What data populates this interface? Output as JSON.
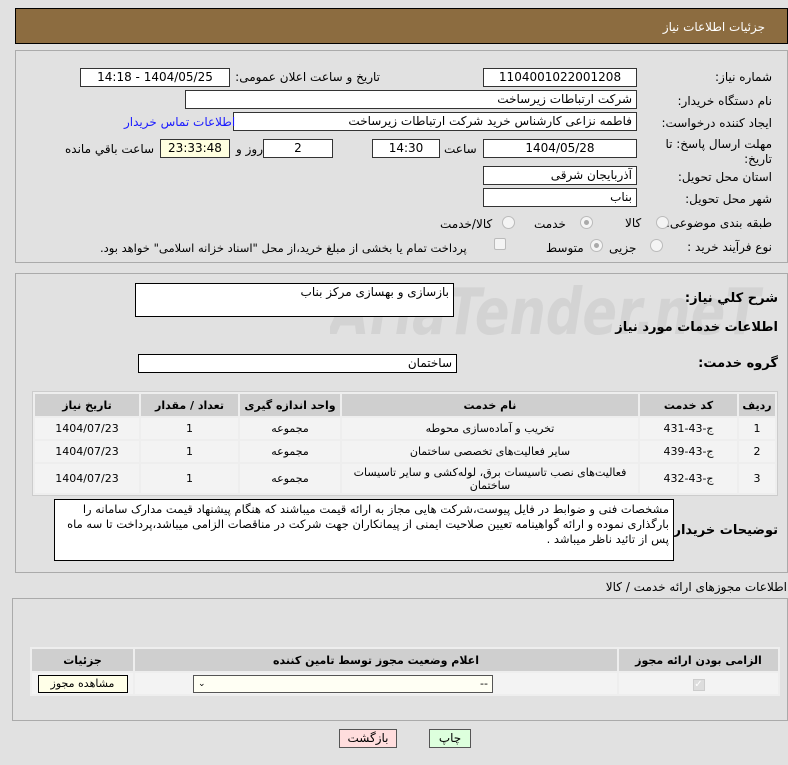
{
  "header": {
    "title": "جزئیات اطلاعات نیاز"
  },
  "form": {
    "need_number_label": "شماره نیاز:",
    "need_number": "1104001022001208",
    "announce_label": "تاریخ و ساعت اعلان عمومی:",
    "announce_value": "1404/05/25 - 14:18",
    "buyer_label": "نام دستگاه خریدار:",
    "buyer": "شرکت ارتباطات زیرساخت",
    "creator_label": "ایجاد کننده درخواست:",
    "creator": "فاطمه نزاعی کارشناس خرید شرکت ارتباطات زیرساخت",
    "contact_link": "اطلاعات تماس خریدار",
    "deadline_label": "مهلت ارسال پاسخ: تا تاریخ:",
    "deadline_date": "1404/05/28",
    "time_label": "ساعت",
    "deadline_time": "14:30",
    "days": "2",
    "days_label": "روز و",
    "remaining": "23:33:48",
    "remaining_label": "ساعت باقي مانده",
    "province_label": "استان محل تحویل:",
    "province": "آذربایجان شرقی",
    "city_label": "شهر محل تحویل:",
    "city": "بناب",
    "category_label": "طبقه بندی موضوعی:",
    "category_options": [
      "کالا",
      "خدمت",
      "کالا/خدمت"
    ],
    "process_label": "نوع فرآیند خرید :",
    "process_options": [
      "جزیی",
      "متوسط"
    ],
    "payment_note": "پرداخت تمام یا بخشی از مبلغ خرید،از محل \"اسناد خزانه اسلامی\" خواهد بود."
  },
  "details": {
    "desc_label": "شرح کلي نياز:",
    "desc": "بازسازی و بهسازی مرکز بناب",
    "services_title": "اطلاعات خدمات مورد نياز",
    "group_label": "گروه خدمت:",
    "group": "ساختمان",
    "columns": [
      "ردیف",
      "کد خدمت",
      "نام خدمت",
      "واحد اندازه گیری",
      "تعداد / مقدار",
      "تاریخ نیاز"
    ],
    "rows": [
      [
        "1",
        "ج-43-431",
        "تخریب و آماده‌سازی محوطه",
        "مجموعه",
        "1",
        "1404/07/23"
      ],
      [
        "2",
        "ج-43-439",
        "سایر فعالیت‌های تخصصی ساختمان",
        "مجموعه",
        "1",
        "1404/07/23"
      ],
      [
        "3",
        "ج-43-432",
        "فعالیت‌های نصب تاسیسات برق، لوله‌کشی و سایر تاسیسات ساختمان",
        "مجموعه",
        "1",
        "1404/07/23"
      ]
    ],
    "notes_label": "توضیحات خریدار:",
    "notes": "مشخصات فنی و ضوابط در فایل پیوست،شرکت هایی مجاز به ارائه قیمت میباشند که هنگام پیشنهاد قیمت مدارک سامانه را بارگذاری نموده و ارائه گواهینامه تعیین صلاحیت ایمنی از پیمانکاران جهت شرکت در مناقصات الزامی میباشد،پرداخت تا سه ماه پس از تائید ناظر میباشد ."
  },
  "permits": {
    "title": "اطلاعات مجوزهای ارائه خدمت / کالا",
    "columns": [
      "الزامی بودن ارائه مجوز",
      "اعلام وضعیت مجوز توسط تامین کننده",
      "جزئیات"
    ],
    "select_value": "--",
    "view_button": "مشاهده مجوز"
  },
  "buttons": {
    "back": "بازگشت",
    "print": "چاپ"
  },
  "watermark": "AriaTender.neT"
}
